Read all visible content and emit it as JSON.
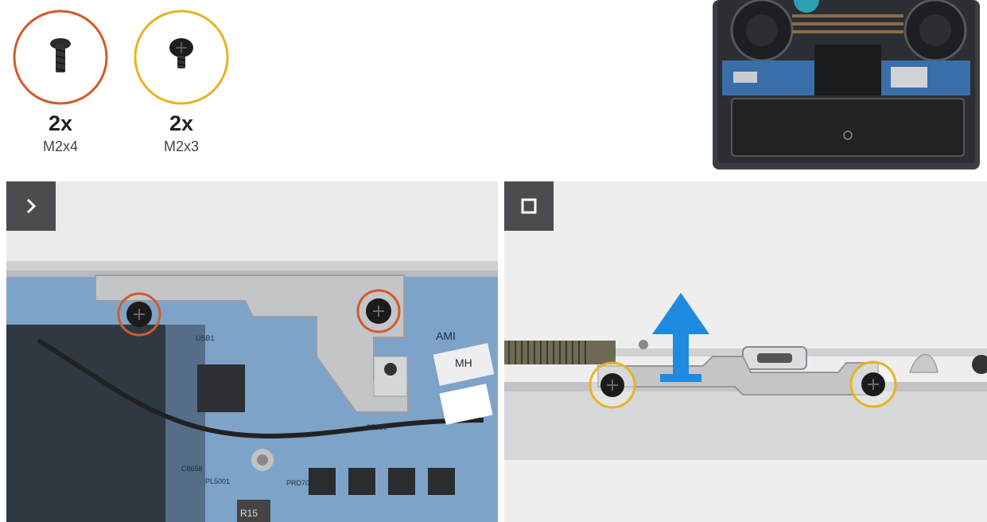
{
  "screws": [
    {
      "quantity": "2x",
      "size": "M2x4",
      "ring_color": "#d35a2a"
    },
    {
      "quantity": "2x",
      "size": "M2x3",
      "ring_color": "#e6b422"
    }
  ],
  "overview": {
    "label": "laptop-base-overview-photo"
  },
  "steps": [
    {
      "marker_icon": "chevron-right-icon",
      "screws_color": "#d35a2a"
    },
    {
      "marker_icon": "square-icon",
      "screws_color": "#e6b422",
      "arrow_color": "#1f8ae0"
    }
  ],
  "callouts": {
    "board_labels": [
      "USB1",
      "C7180",
      "AMI",
      "MH",
      "PL5001",
      "R15",
      "PRD702",
      "C8658"
    ]
  }
}
